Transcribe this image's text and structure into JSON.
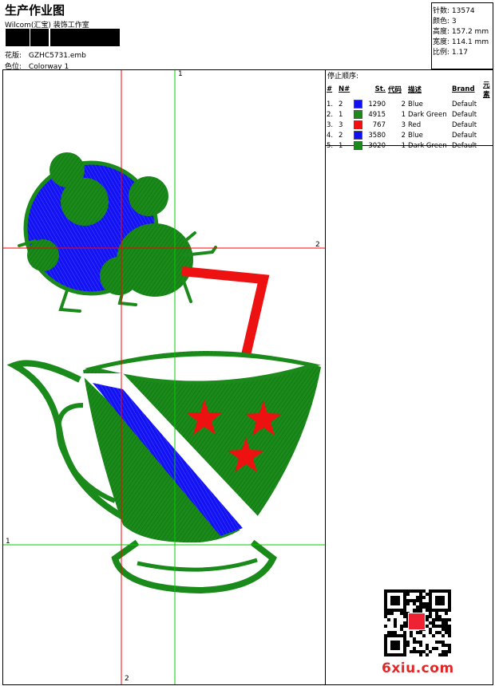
{
  "header": {
    "title": "生产作业图",
    "studio": "Wilcom(汇宝) 装饰工作室",
    "design_label": "花版:",
    "design_value": "GZHC5731.emb",
    "colorway_label": "色位:",
    "colorway_value": "Colorway 1"
  },
  "stats": [
    {
      "label": "针数:",
      "value": "13574"
    },
    {
      "label": "颜色:",
      "value": "3"
    },
    {
      "label": "高度:",
      "value": "157.2 mm"
    },
    {
      "label": "宽度:",
      "value": "114.1 mm"
    },
    {
      "label": "比例:",
      "value": "1.17"
    }
  ],
  "stop_sequence": {
    "title": "停止顺序:",
    "headers": [
      "#",
      "N#",
      "St.",
      "代码",
      "描述",
      "Brand",
      "元素"
    ],
    "rows": [
      {
        "idx": "1.",
        "n": "2",
        "color": "#1010f0",
        "st": "1290",
        "code": "2",
        "desc": "Blue",
        "brand": "Default"
      },
      {
        "idx": "2.",
        "n": "1",
        "color": "#1a8a1a",
        "st": "4915",
        "code": "1",
        "desc": "Dark Green",
        "brand": "Default"
      },
      {
        "idx": "3.",
        "n": "3",
        "color": "#f01010",
        "st": "767",
        "code": "3",
        "desc": "Red",
        "brand": "Default"
      },
      {
        "idx": "4.",
        "n": "2",
        "color": "#1010f0",
        "st": "3580",
        "code": "2",
        "desc": "Blue",
        "brand": "Default"
      },
      {
        "idx": "5.",
        "n": "1",
        "color": "#1a8a1a",
        "st": "3020",
        "code": "1",
        "desc": "Dark Green",
        "brand": "Default"
      }
    ]
  },
  "guides": {
    "top": "1",
    "right": "2",
    "left": "1",
    "bottom": "2"
  },
  "watermark": "6xiu.com",
  "colors": {
    "blue": "#1010f0",
    "green": "#1a8a1a",
    "red": "#f01010",
    "guide_green": "#00cc00",
    "guide_red": "#ff0000"
  }
}
